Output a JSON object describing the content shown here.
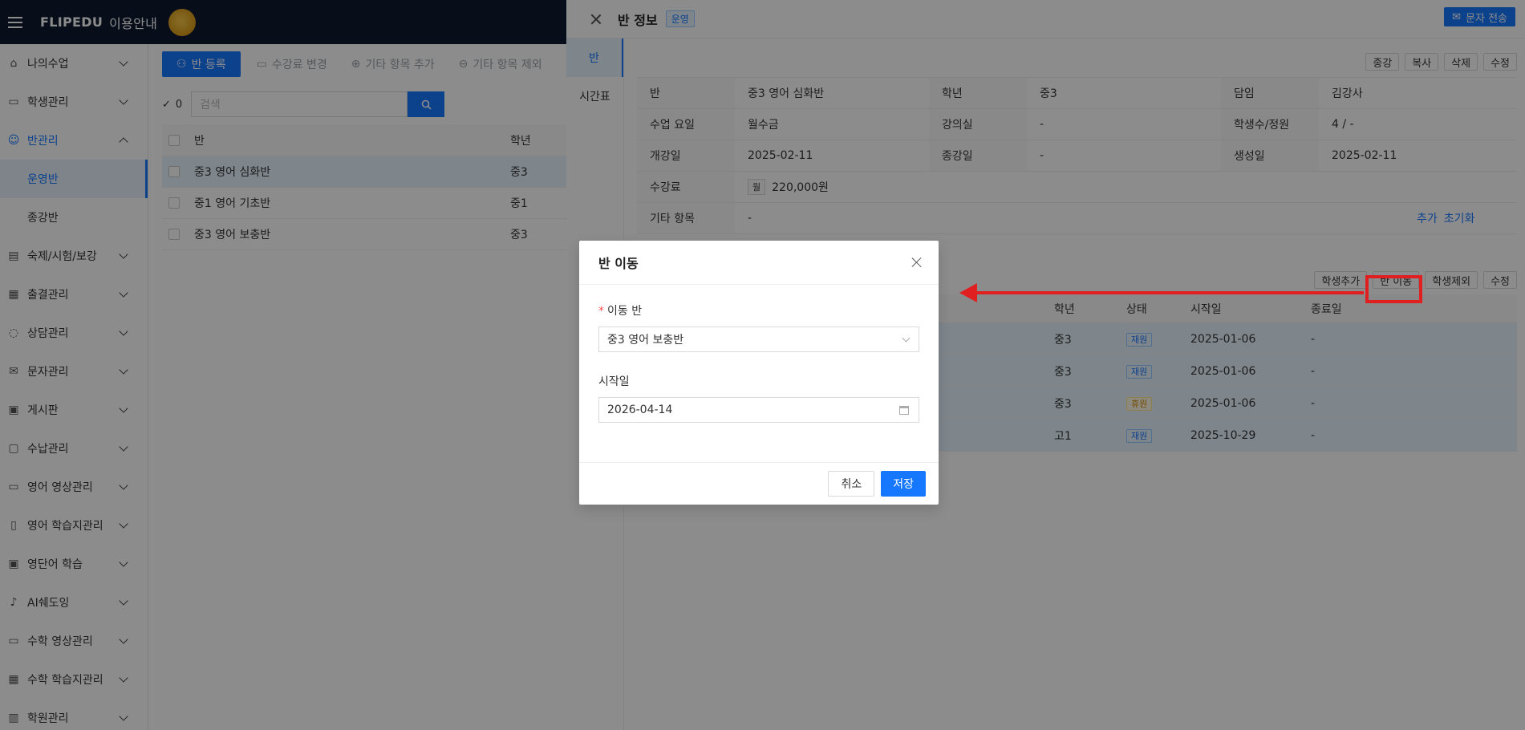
{
  "header": {
    "brand": "FLIPEDU",
    "guide": "이용안내"
  },
  "sidebar": {
    "items": [
      {
        "label": "나의수업",
        "icon": "home-icon"
      },
      {
        "label": "학생관리",
        "icon": "id-card-icon"
      },
      {
        "label": "반관리",
        "icon": "users-icon"
      },
      {
        "label": "숙제/시험/보강",
        "icon": "document-icon"
      },
      {
        "label": "출결관리",
        "icon": "calendar-icon"
      },
      {
        "label": "상담관리",
        "icon": "chat-icon"
      },
      {
        "label": "문자관리",
        "icon": "mail-icon"
      },
      {
        "label": "게시판",
        "icon": "board-icon"
      },
      {
        "label": "수납관리",
        "icon": "payment-icon"
      },
      {
        "label": "영어 영상관리",
        "icon": "monitor-icon"
      },
      {
        "label": "영어 학습지관리",
        "icon": "book-icon"
      },
      {
        "label": "영단어 학습",
        "icon": "vocab-icon"
      },
      {
        "label": "AI쉐도잉",
        "icon": "microphone-icon"
      },
      {
        "label": "수학 영상관리",
        "icon": "monitor-icon"
      },
      {
        "label": "수학 학습지관리",
        "icon": "calculator-icon"
      },
      {
        "label": "학원관리",
        "icon": "building-icon"
      }
    ],
    "sub_items": [
      "운영반",
      "종강반"
    ]
  },
  "toolbar": {
    "register": "반 등록",
    "change_fee": "수강료 변경",
    "add_extra": "기타 항목 추가",
    "remove_extra": "기타 항목 제외"
  },
  "search": {
    "count": "0",
    "placeholder": "검색"
  },
  "class_table": {
    "headers": [
      "반",
      "학년"
    ],
    "rows": [
      {
        "name": "중3 영어 심화반",
        "grade": "중3"
      },
      {
        "name": "중1 영어 기초반",
        "grade": "중1"
      },
      {
        "name": "중3 영어 보충반",
        "grade": "중3"
      }
    ]
  },
  "drawer": {
    "title": "반 정보",
    "status_tag": "운영",
    "sms_button": "문자 전송",
    "tabs": [
      "반",
      "시간표"
    ],
    "actions": [
      "종강",
      "복사",
      "삭제",
      "수정"
    ],
    "info": {
      "class_label": "반",
      "class_value": "중3 영어 심화반",
      "grade_label": "학년",
      "grade_value": "중3",
      "teacher_label": "담임",
      "teacher_value": "김강사",
      "days_label": "수업 요일",
      "days_value": "월수금",
      "room_label": "강의실",
      "room_value": "-",
      "students_label": "학생수/정원",
      "students_value": "4 / -",
      "start_label": "개강일",
      "start_value": "2025-02-11",
      "end_label": "종강일",
      "end_value": "-",
      "created_label": "생성일",
      "created_value": "2025-02-11",
      "fee_label": "수강료",
      "fee_badge": "월",
      "fee_value": "220,000원",
      "extra_label": "기타 항목",
      "extra_value": "-",
      "extra_add": "추가",
      "extra_reset": "초기화"
    },
    "student_actions": [
      "학생추가",
      "반 이동",
      "학생제외",
      "수정"
    ],
    "student_headers": [
      "학년",
      "상태",
      "시작일",
      "종료일"
    ],
    "students": [
      {
        "grade": "중3",
        "status": "재원",
        "start": "2025-01-06",
        "end": "-",
        "status_type": "blue"
      },
      {
        "grade": "중3",
        "status": "재원",
        "start": "2025-01-06",
        "end": "-",
        "status_type": "blue"
      },
      {
        "grade": "중3",
        "status": "휴원",
        "start": "2025-01-06",
        "end": "-",
        "status_type": "orange"
      },
      {
        "grade": "고1",
        "status": "재원",
        "start": "2025-10-29",
        "end": "-",
        "status_type": "blue"
      }
    ]
  },
  "modal": {
    "title": "반 이동",
    "class_label": "이동 반",
    "class_value": "중3 영어 보충반",
    "date_label": "시작일",
    "date_value": "2026-04-14",
    "cancel": "취소",
    "save": "저장"
  },
  "colors": {
    "primary": "#1677ff",
    "header_bg": "#0e1b30",
    "annotation": "#e02020"
  }
}
